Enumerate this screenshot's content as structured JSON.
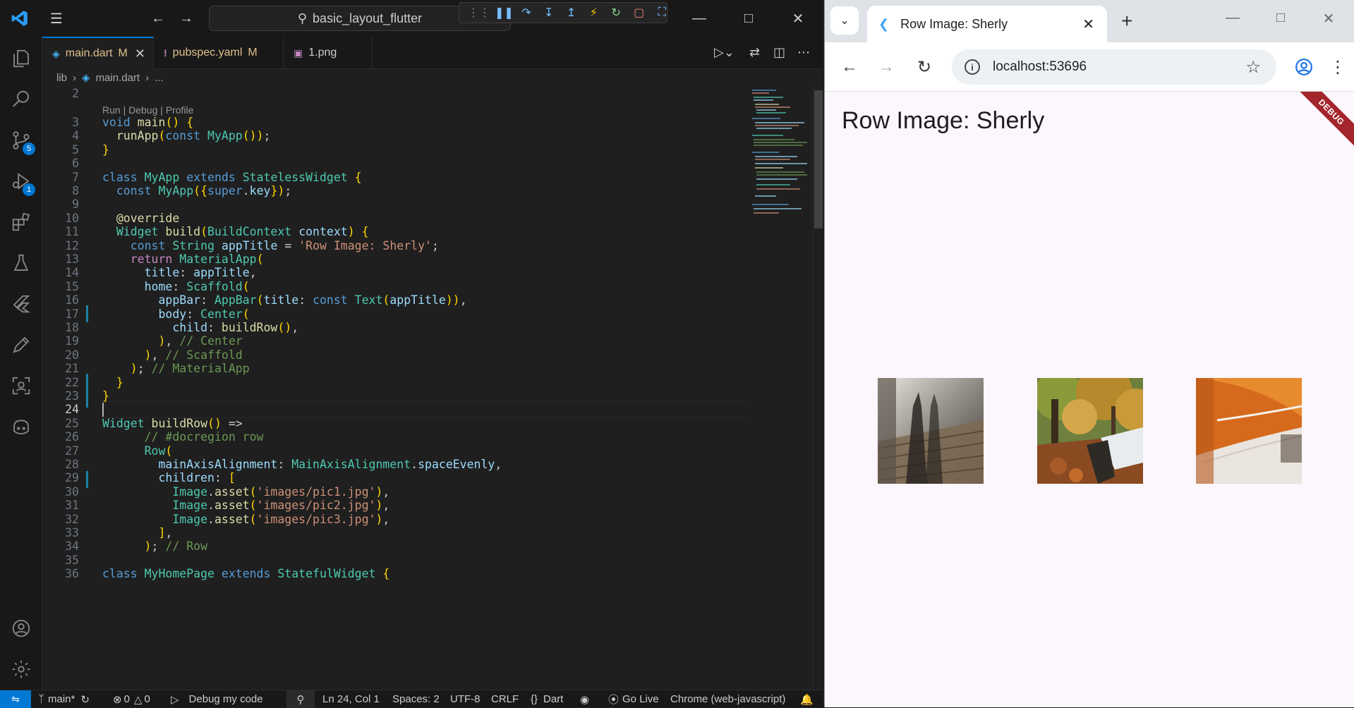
{
  "vscode": {
    "command_center": "basic_layout_flutter",
    "tabs": [
      {
        "label": "main.dart",
        "status": "M",
        "icon": "dart-icon"
      },
      {
        "label": "pubspec.yaml",
        "status": "M",
        "icon": "yaml-icon"
      },
      {
        "label": "1.png",
        "status": "",
        "icon": "image-icon"
      }
    ],
    "breadcrumb": [
      "lib",
      "main.dart",
      "..."
    ],
    "activity_badges": {
      "source_control": "5",
      "run_debug": "1"
    },
    "codelens": "Run | Debug | Profile",
    "line_numbers": [
      "2",
      "3",
      "4",
      "5",
      "6",
      "7",
      "8",
      "9",
      "10",
      "11",
      "12",
      "13",
      "14",
      "15",
      "16",
      "17",
      "18",
      "19",
      "20",
      "21",
      "22",
      "23",
      "24",
      "25",
      "26",
      "27",
      "28",
      "29",
      "30",
      "31",
      "32",
      "33",
      "34",
      "35",
      "36"
    ],
    "code_lines": [
      "",
      "void main() {",
      "  runApp(const MyApp());",
      "}",
      "",
      "class MyApp extends StatelessWidget {",
      "  const MyApp({super.key});",
      "",
      "  @override",
      "  Widget build(BuildContext context) {",
      "    const String appTitle = 'Row Image: Sherly';",
      "    return MaterialApp(",
      "      title: appTitle,",
      "      home: Scaffold(",
      "        appBar: AppBar(title: const Text(appTitle)),",
      "        body: Center(",
      "          child: buildRow(),",
      "        ), // Center",
      "      ), // Scaffold",
      "    ); // MaterialApp",
      "  }",
      "}",
      "",
      "Widget buildRow() =>",
      "      // #docregion row",
      "      Row(",
      "        mainAxisAlignment: MainAxisAlignment.spaceEvenly,",
      "        children: [",
      "          Image.asset('images/pic1.jpg'),",
      "          Image.asset('images/pic2.jpg'),",
      "          Image.asset('images/pic3.jpg'),",
      "        ],",
      "      ); // Row",
      "",
      "class MyHomePage extends StatefulWidget {"
    ],
    "statusbar": {
      "branch": "main*",
      "errors": "0",
      "warnings": "0",
      "debug_config": "Debug my code",
      "cursor_pos": "Ln 24, Col 1",
      "spaces": "Spaces: 2",
      "encoding": "UTF-8",
      "eol": "CRLF",
      "language": "Dart",
      "go_live": "Go Live",
      "device": "Chrome (web-javascript)"
    },
    "colors": {
      "accent": "#0078d4",
      "editor_bg": "#1f1f1f"
    }
  },
  "chrome": {
    "tab_title": "Row Image: Sherly",
    "url": "localhost:53696",
    "page": {
      "appbar_title": "Row Image: Sherly",
      "debug_banner": "DEBUG",
      "images": [
        "images/pic1.jpg",
        "images/pic2.jpg",
        "images/pic3.jpg"
      ]
    }
  }
}
